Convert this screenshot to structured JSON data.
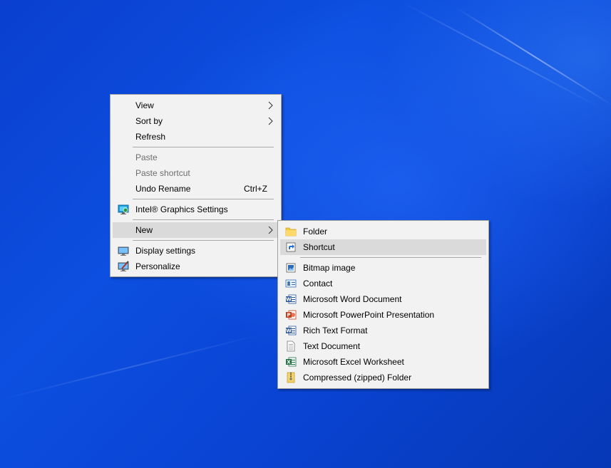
{
  "context_menu": {
    "items": [
      {
        "label": "View"
      },
      {
        "label": "Sort by"
      },
      {
        "label": "Refresh"
      },
      {
        "label": "Paste"
      },
      {
        "label": "Paste shortcut"
      },
      {
        "label": "Undo Rename",
        "shortcut": "Ctrl+Z"
      },
      {
        "label": "Intel® Graphics Settings",
        "icon": "intel-graphics-icon"
      },
      {
        "label": "New"
      },
      {
        "label": "Display settings",
        "icon": "display-icon"
      },
      {
        "label": "Personalize",
        "icon": "personalize-icon"
      }
    ]
  },
  "new_submenu": {
    "items": [
      {
        "label": "Folder",
        "icon": "folder-icon"
      },
      {
        "label": "Shortcut",
        "icon": "shortcut-icon"
      },
      {
        "label": "Bitmap image",
        "icon": "bitmap-icon"
      },
      {
        "label": "Contact",
        "icon": "contact-icon"
      },
      {
        "label": "Microsoft Word Document",
        "icon": "word-icon"
      },
      {
        "label": "Microsoft PowerPoint Presentation",
        "icon": "powerpoint-icon"
      },
      {
        "label": "Rich Text Format",
        "icon": "rtf-icon"
      },
      {
        "label": "Text Document",
        "icon": "text-document-icon"
      },
      {
        "label": "Microsoft Excel Worksheet",
        "icon": "excel-icon"
      },
      {
        "label": "Compressed (zipped) Folder",
        "icon": "zip-folder-icon"
      }
    ]
  },
  "colors": {
    "desktop_blue": "#0a45d6",
    "menu_bg": "#f2f2f2",
    "hover_bg": "#dadada",
    "disabled_text": "#6d6d6d"
  }
}
